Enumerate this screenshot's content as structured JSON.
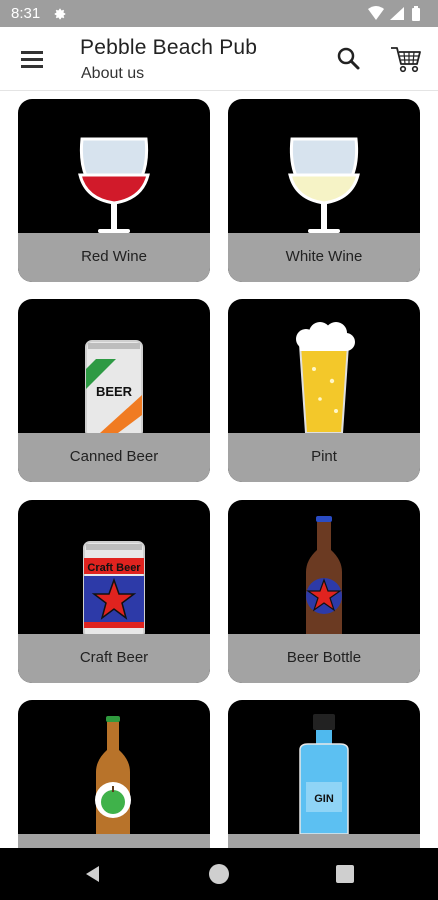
{
  "status_bar": {
    "time": "8:31"
  },
  "app_bar": {
    "title": "Pebble Beach Pub",
    "subtitle": "About us"
  },
  "icons": {
    "menu": "menu-icon",
    "search": "search-icon",
    "cart": "cart-icon",
    "settings": "gear-icon"
  },
  "colors": {
    "status_bar_bg": "#9e9e9e",
    "card_bg": "#000000",
    "label_bg": "#a3a3a3",
    "nav_bar_bg": "#000000"
  },
  "products": [
    {
      "label": "Red Wine"
    },
    {
      "label": "White Wine"
    },
    {
      "label": "Canned Beer",
      "art_text": "BEER"
    },
    {
      "label": "Pint"
    },
    {
      "label": "Craft Beer",
      "art_text": "Craft Beer"
    },
    {
      "label": "Beer Bottle"
    },
    {
      "label": ""
    },
    {
      "label": "",
      "art_text": "GIN"
    }
  ]
}
